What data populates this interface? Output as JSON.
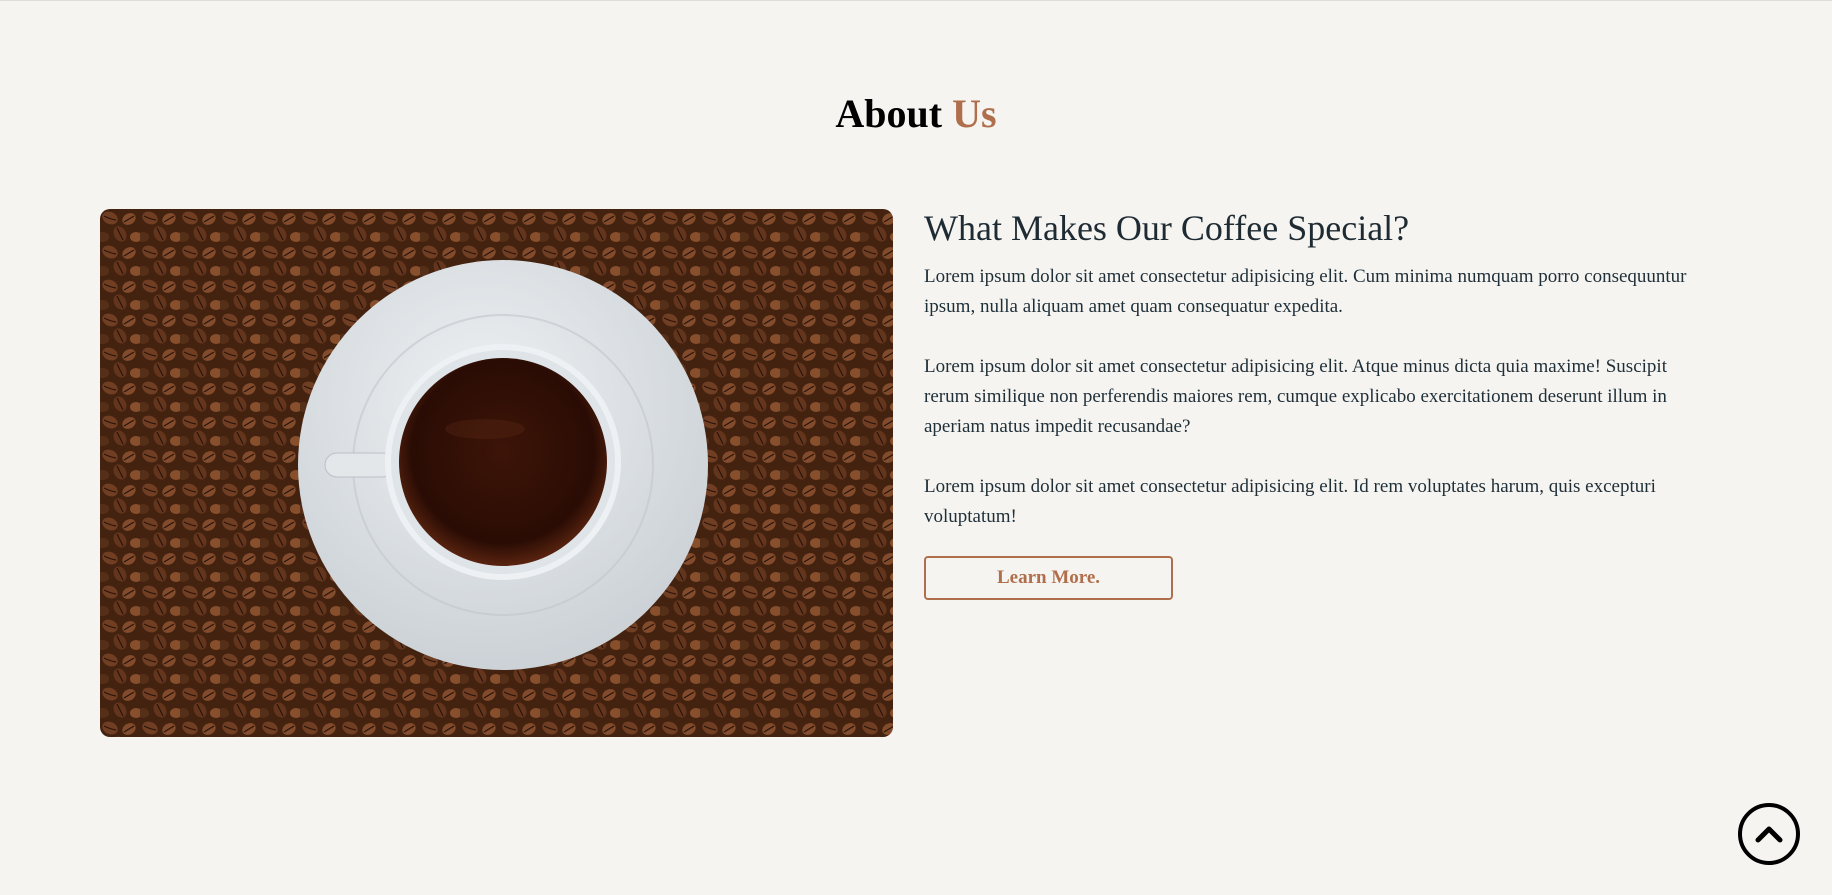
{
  "section": {
    "title_part1": "About",
    "title_part2": "Us"
  },
  "about": {
    "heading": "What Makes Our Coffee Special?",
    "paragraphs": [
      "Lorem ipsum dolor sit amet consectetur adipisicing elit. Cum minima numquam porro consequuntur ipsum, nulla aliquam amet quam consequatur expedita.",
      "Lorem ipsum dolor sit amet consectetur adipisicing elit. Atque minus dicta quia maxime! Suscipit rerum similique non perferendis maiores rem, cumque explicabo exercitationem deserunt illum in aperiam natus impedit recusandae?",
      "Lorem ipsum dolor sit amet consectetur adipisicing elit. Id rem voluptates harum, quis excepturi voluptatum!"
    ],
    "button_label": "Learn More."
  },
  "scroll_top": {
    "icon": "chevron-up-circle-icon"
  },
  "colors": {
    "accent": "#b06f4c",
    "background": "#f6f4f1",
    "text": "#1f2f38"
  }
}
